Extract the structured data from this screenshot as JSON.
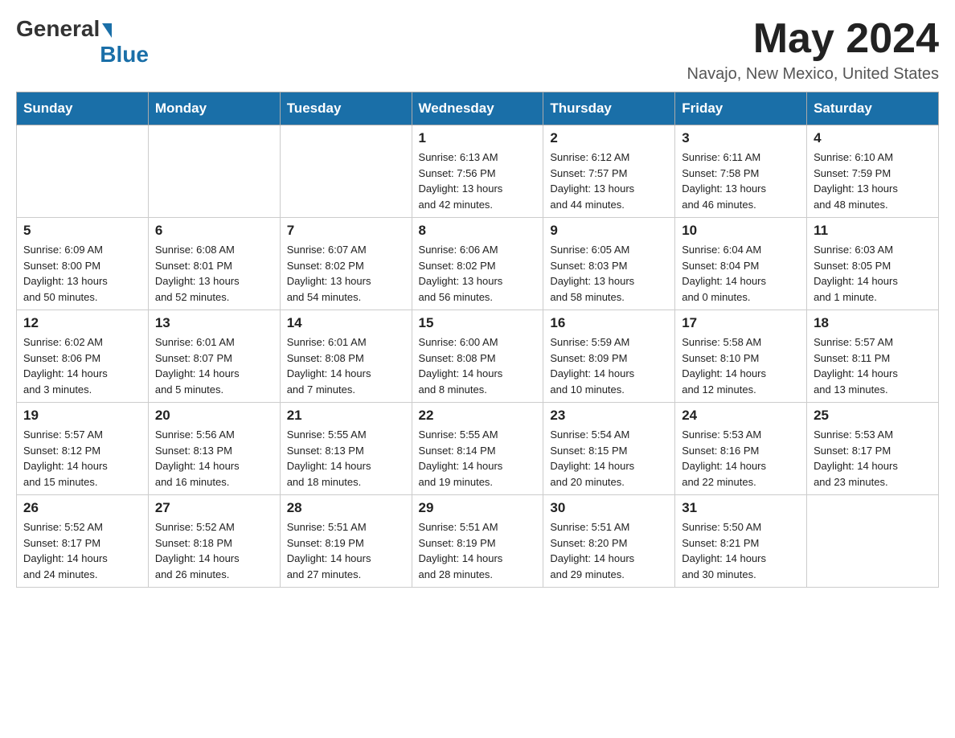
{
  "header": {
    "logo_general": "General",
    "logo_blue": "Blue",
    "month_title": "May 2024",
    "location": "Navajo, New Mexico, United States"
  },
  "days_of_week": [
    "Sunday",
    "Monday",
    "Tuesday",
    "Wednesday",
    "Thursday",
    "Friday",
    "Saturday"
  ],
  "weeks": [
    [
      {
        "day": "",
        "info": ""
      },
      {
        "day": "",
        "info": ""
      },
      {
        "day": "",
        "info": ""
      },
      {
        "day": "1",
        "info": "Sunrise: 6:13 AM\nSunset: 7:56 PM\nDaylight: 13 hours\nand 42 minutes."
      },
      {
        "day": "2",
        "info": "Sunrise: 6:12 AM\nSunset: 7:57 PM\nDaylight: 13 hours\nand 44 minutes."
      },
      {
        "day": "3",
        "info": "Sunrise: 6:11 AM\nSunset: 7:58 PM\nDaylight: 13 hours\nand 46 minutes."
      },
      {
        "day": "4",
        "info": "Sunrise: 6:10 AM\nSunset: 7:59 PM\nDaylight: 13 hours\nand 48 minutes."
      }
    ],
    [
      {
        "day": "5",
        "info": "Sunrise: 6:09 AM\nSunset: 8:00 PM\nDaylight: 13 hours\nand 50 minutes."
      },
      {
        "day": "6",
        "info": "Sunrise: 6:08 AM\nSunset: 8:01 PM\nDaylight: 13 hours\nand 52 minutes."
      },
      {
        "day": "7",
        "info": "Sunrise: 6:07 AM\nSunset: 8:02 PM\nDaylight: 13 hours\nand 54 minutes."
      },
      {
        "day": "8",
        "info": "Sunrise: 6:06 AM\nSunset: 8:02 PM\nDaylight: 13 hours\nand 56 minutes."
      },
      {
        "day": "9",
        "info": "Sunrise: 6:05 AM\nSunset: 8:03 PM\nDaylight: 13 hours\nand 58 minutes."
      },
      {
        "day": "10",
        "info": "Sunrise: 6:04 AM\nSunset: 8:04 PM\nDaylight: 14 hours\nand 0 minutes."
      },
      {
        "day": "11",
        "info": "Sunrise: 6:03 AM\nSunset: 8:05 PM\nDaylight: 14 hours\nand 1 minute."
      }
    ],
    [
      {
        "day": "12",
        "info": "Sunrise: 6:02 AM\nSunset: 8:06 PM\nDaylight: 14 hours\nand 3 minutes."
      },
      {
        "day": "13",
        "info": "Sunrise: 6:01 AM\nSunset: 8:07 PM\nDaylight: 14 hours\nand 5 minutes."
      },
      {
        "day": "14",
        "info": "Sunrise: 6:01 AM\nSunset: 8:08 PM\nDaylight: 14 hours\nand 7 minutes."
      },
      {
        "day": "15",
        "info": "Sunrise: 6:00 AM\nSunset: 8:08 PM\nDaylight: 14 hours\nand 8 minutes."
      },
      {
        "day": "16",
        "info": "Sunrise: 5:59 AM\nSunset: 8:09 PM\nDaylight: 14 hours\nand 10 minutes."
      },
      {
        "day": "17",
        "info": "Sunrise: 5:58 AM\nSunset: 8:10 PM\nDaylight: 14 hours\nand 12 minutes."
      },
      {
        "day": "18",
        "info": "Sunrise: 5:57 AM\nSunset: 8:11 PM\nDaylight: 14 hours\nand 13 minutes."
      }
    ],
    [
      {
        "day": "19",
        "info": "Sunrise: 5:57 AM\nSunset: 8:12 PM\nDaylight: 14 hours\nand 15 minutes."
      },
      {
        "day": "20",
        "info": "Sunrise: 5:56 AM\nSunset: 8:13 PM\nDaylight: 14 hours\nand 16 minutes."
      },
      {
        "day": "21",
        "info": "Sunrise: 5:55 AM\nSunset: 8:13 PM\nDaylight: 14 hours\nand 18 minutes."
      },
      {
        "day": "22",
        "info": "Sunrise: 5:55 AM\nSunset: 8:14 PM\nDaylight: 14 hours\nand 19 minutes."
      },
      {
        "day": "23",
        "info": "Sunrise: 5:54 AM\nSunset: 8:15 PM\nDaylight: 14 hours\nand 20 minutes."
      },
      {
        "day": "24",
        "info": "Sunrise: 5:53 AM\nSunset: 8:16 PM\nDaylight: 14 hours\nand 22 minutes."
      },
      {
        "day": "25",
        "info": "Sunrise: 5:53 AM\nSunset: 8:17 PM\nDaylight: 14 hours\nand 23 minutes."
      }
    ],
    [
      {
        "day": "26",
        "info": "Sunrise: 5:52 AM\nSunset: 8:17 PM\nDaylight: 14 hours\nand 24 minutes."
      },
      {
        "day": "27",
        "info": "Sunrise: 5:52 AM\nSunset: 8:18 PM\nDaylight: 14 hours\nand 26 minutes."
      },
      {
        "day": "28",
        "info": "Sunrise: 5:51 AM\nSunset: 8:19 PM\nDaylight: 14 hours\nand 27 minutes."
      },
      {
        "day": "29",
        "info": "Sunrise: 5:51 AM\nSunset: 8:19 PM\nDaylight: 14 hours\nand 28 minutes."
      },
      {
        "day": "30",
        "info": "Sunrise: 5:51 AM\nSunset: 8:20 PM\nDaylight: 14 hours\nand 29 minutes."
      },
      {
        "day": "31",
        "info": "Sunrise: 5:50 AM\nSunset: 8:21 PM\nDaylight: 14 hours\nand 30 minutes."
      },
      {
        "day": "",
        "info": ""
      }
    ]
  ]
}
